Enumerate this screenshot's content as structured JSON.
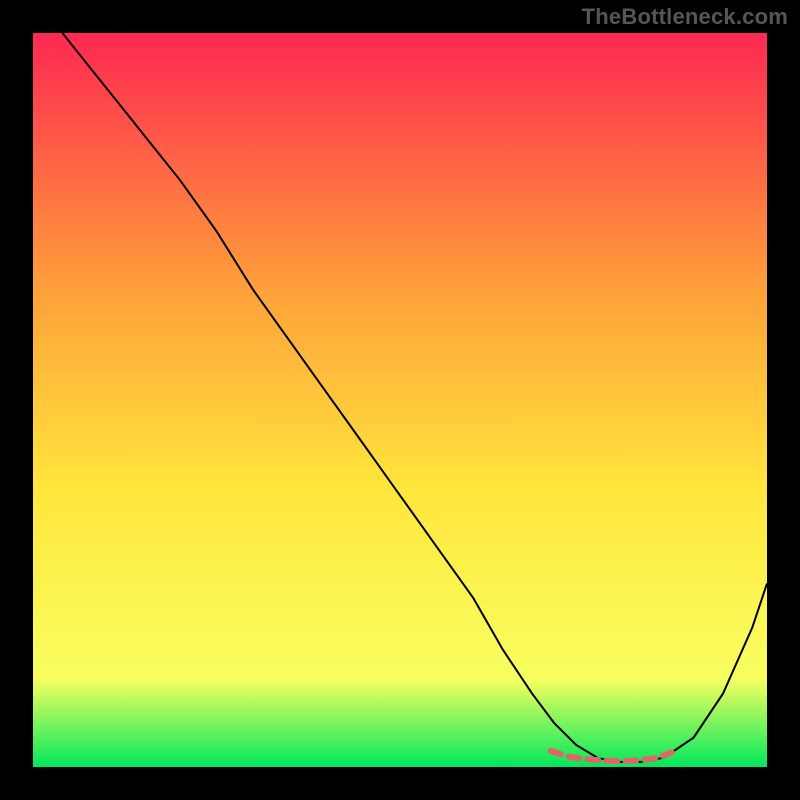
{
  "watermark": "TheBottleneck.com",
  "chart_data": {
    "type": "line",
    "title": "",
    "xlabel": "",
    "ylabel": "",
    "xlim": [
      0,
      100
    ],
    "ylim": [
      0,
      100
    ],
    "background_gradient": {
      "top": "#ff2851",
      "mid_upper": "#ffa03a",
      "mid": "#ffe63c",
      "mid_lower": "#f8ff60",
      "bottom": "#00e85c"
    },
    "series": [
      {
        "name": "bottleneck-curve",
        "x": [
          4,
          8,
          12,
          16,
          20,
          25,
          30,
          35,
          40,
          45,
          50,
          55,
          60,
          64,
          68,
          71,
          74,
          77,
          80,
          83,
          86,
          90,
          94,
          98,
          100
        ],
        "y": [
          100,
          95,
          90,
          85,
          80,
          73,
          65,
          58,
          51,
          44,
          37,
          30,
          23,
          16,
          10,
          6,
          3,
          1.2,
          0.7,
          0.7,
          1.3,
          4,
          10,
          19,
          25
        ],
        "color": "#000000",
        "stroke_width": 2
      }
    ],
    "highlight": {
      "name": "optimal-range",
      "x": [
        70.5,
        73,
        75,
        77.5,
        80,
        82.5,
        85,
        87
      ],
      "y": [
        2.2,
        1.4,
        1.1,
        0.9,
        0.8,
        0.9,
        1.2,
        2.0
      ],
      "color": "#e06666",
      "stroke_width": 6,
      "dash": "11 8"
    }
  }
}
